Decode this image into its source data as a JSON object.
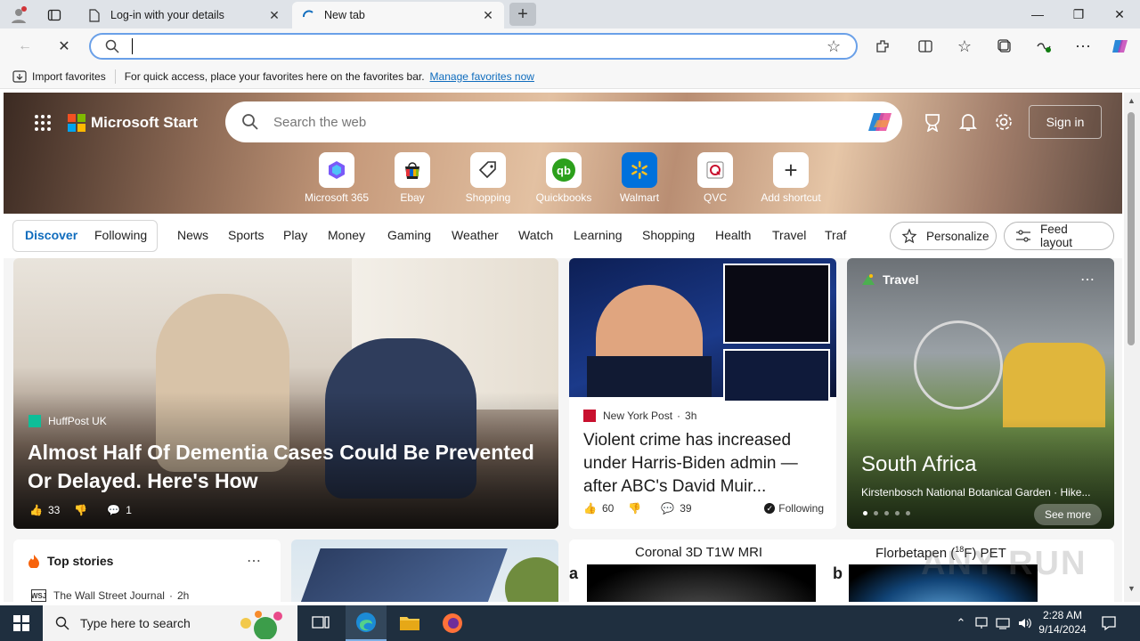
{
  "browser": {
    "tabs": [
      {
        "title": "Log-in with your details",
        "active": false
      },
      {
        "title": "New tab",
        "active": true
      }
    ],
    "address": {
      "value": ""
    },
    "favorites_bar": {
      "import_label": "Import favorites",
      "message": "For quick access, place your favorites here on the favorites bar.",
      "manage_link": "Manage favorites now"
    }
  },
  "page": {
    "brand": "Microsoft Start",
    "search_placeholder": "Search the web",
    "sign_in": "Sign in",
    "shortcuts": [
      {
        "label": "Microsoft 365",
        "icon": "microsoft365-icon"
      },
      {
        "label": "Ebay",
        "icon": "ebay-icon"
      },
      {
        "label": "Shopping",
        "icon": "shopping-tag-icon"
      },
      {
        "label": "Quickbooks",
        "icon": "quickbooks-icon"
      },
      {
        "label": "Walmart",
        "icon": "walmart-icon"
      },
      {
        "label": "QVC",
        "icon": "qvc-icon"
      },
      {
        "label": "Add shortcut",
        "icon": "plus-icon"
      }
    ],
    "feed_tabs": [
      "Discover",
      "Following"
    ],
    "categories": [
      "News",
      "Sports",
      "Play",
      "Money",
      "Gaming",
      "Weather",
      "Watch",
      "Learning",
      "Shopping",
      "Health",
      "Travel",
      "Traf"
    ],
    "personalize": "Personalize",
    "feed_layout": "Feed layout",
    "cards": {
      "main": {
        "source": "HuffPost UK",
        "headline": "Almost Half Of Dementia Cases Could Be Prevented Or Delayed. Here's How",
        "likes": "33",
        "comments": "1"
      },
      "news": {
        "source": "New York Post",
        "age": "3h",
        "headline": "Violent crime has increased under Harris-Biden admin — after ABC's David Muir...",
        "likes": "60",
        "comments": "39",
        "following": "Following"
      },
      "travel": {
        "label": "Travel",
        "title": "South Africa",
        "subtitle": "Kirstenbosch National Botanical Garden · Hike...",
        "see_more": "See more"
      },
      "top_stories": {
        "title": "Top stories",
        "source": "The Wall Street Journal",
        "age": "2h",
        "source_badge": "WSJ"
      },
      "science": {
        "label_a": "Coronal 3D T1W MRI",
        "label_b_pre": "Florbetapen (",
        "label_b_sup": "18",
        "label_b_post": "F) PET",
        "panel_a": "a",
        "panel_b": "b"
      }
    }
  },
  "taskbar": {
    "search_placeholder": "Type here to search",
    "time": "2:28 AM",
    "date": "9/14/2024"
  },
  "watermark": "ANY RUN",
  "colors": {
    "accent": "#0f6cbd",
    "taskbar": "#1f2f3f",
    "address_border": "#6aa0e8"
  }
}
